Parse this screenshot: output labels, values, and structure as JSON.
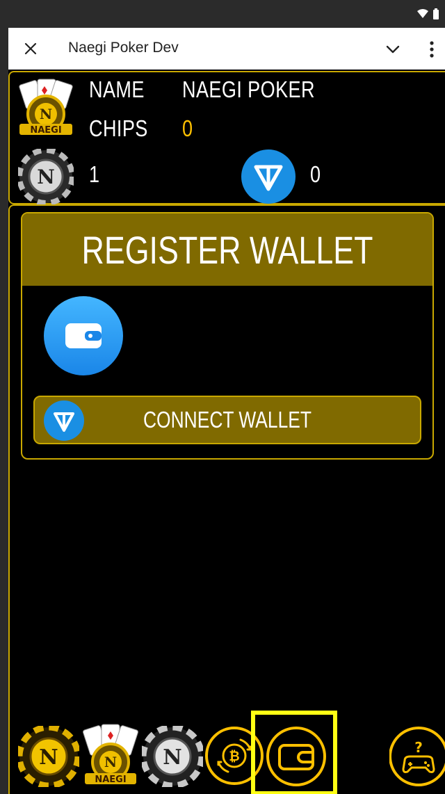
{
  "app": {
    "title": "Naegi Poker Dev"
  },
  "profile": {
    "name_label": "NAME",
    "name_value": "NAEGI POKER",
    "chips_label": "CHIPS",
    "chips_value": "0",
    "n_coin_count": "1",
    "ton_count": "0"
  },
  "wallet": {
    "title": "REGISTER WALLET",
    "connect_label": "CONNECT WALLET"
  },
  "nav": {
    "items": [
      "n-chip-icon",
      "poker-cards-logo-icon",
      "silver-chip-icon",
      "bitcoin-exchange-icon",
      "wallet-icon",
      "game-help-icon"
    ]
  },
  "colors": {
    "gold": "#c9a800",
    "gold_dark": "#806a00",
    "accent_yellow": "#ffc000",
    "ton_blue": "#1a8fe3",
    "highlight": "#ffff14"
  }
}
